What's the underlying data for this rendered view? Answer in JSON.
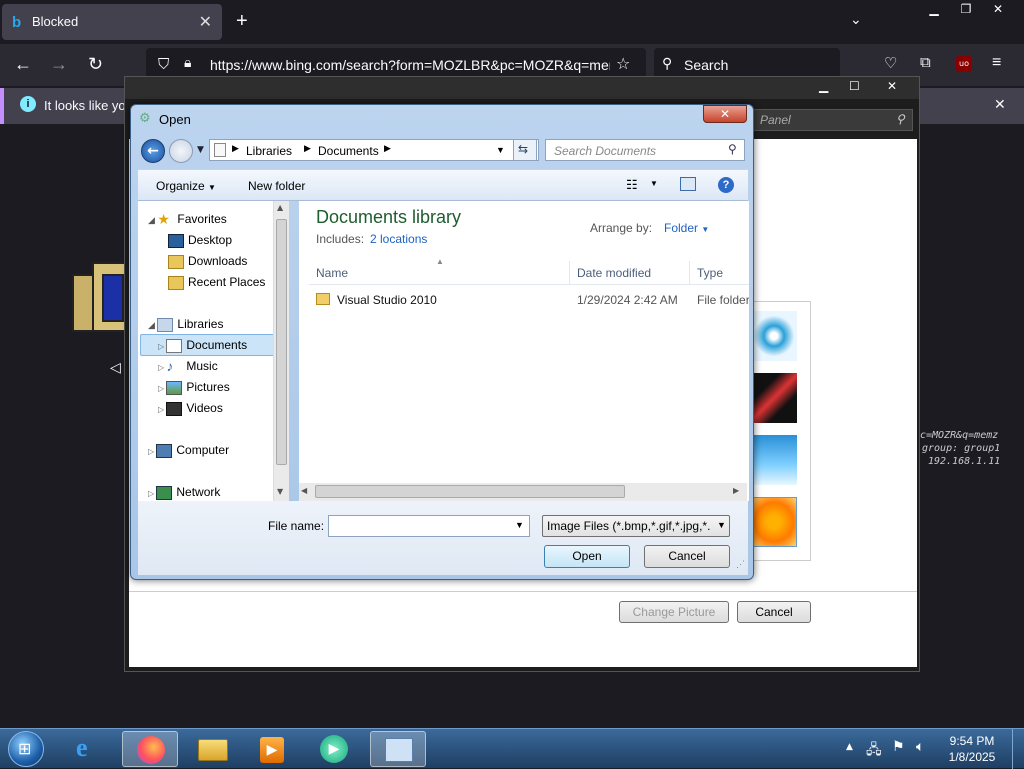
{
  "browser": {
    "tab_title": "Blocked",
    "url": "https://www.bing.com/search?form=MOZLBR&pc=MOZR&q=memz",
    "search_placeholder": "Search",
    "info_text": "It looks like yo"
  },
  "background": {
    "panel_hint": "Panel",
    "mono_lines": [
      "c=MOZR&q=memz",
      "group: group1",
      "192.168.1.11"
    ],
    "change_picture": "Change Picture",
    "cancel": "Cancel"
  },
  "dialog": {
    "title": "Open",
    "breadcrumb": [
      "Libraries",
      "Documents"
    ],
    "search_placeholder": "Search Documents",
    "toolbar": {
      "organize": "Organize",
      "new_folder": "New folder"
    },
    "library_title": "Documents library",
    "includes_label": "Includes:",
    "includes_link": "2 locations",
    "arrange_label": "Arrange by:",
    "arrange_value": "Folder",
    "columns": [
      "Name",
      "Date modified",
      "Type"
    ],
    "files": [
      {
        "name": "Visual Studio 2010",
        "date": "1/29/2024 2:42 AM",
        "type": "File folder"
      }
    ],
    "nav": {
      "favorites": "Favorites",
      "desktop": "Desktop",
      "downloads": "Downloads",
      "recent": "Recent Places",
      "libraries": "Libraries",
      "documents": "Documents",
      "music": "Music",
      "pictures": "Pictures",
      "videos": "Videos",
      "computer": "Computer",
      "network": "Network"
    },
    "file_name_label": "File name:",
    "file_name_value": "",
    "filter": "Image Files (*.bmp,*.gif,*.jpg,*.",
    "open": "Open",
    "cancel": "Cancel"
  },
  "taskbar": {
    "time": "9:54 PM",
    "date": "1/8/2025"
  }
}
